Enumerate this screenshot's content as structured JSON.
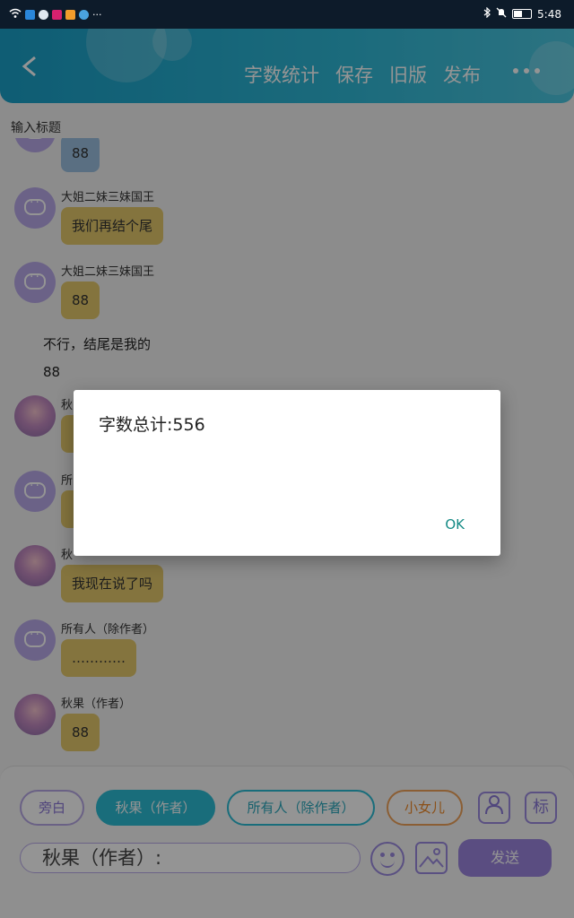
{
  "status_bar": {
    "time": "5:48",
    "battery_level": 0.5,
    "left_icons": [
      "wifi-icon",
      "privacy-icon",
      "cloud-icon",
      "app-badge-icon",
      "play-icon",
      "weather-icon",
      "more-dots-icon"
    ],
    "right_icons": [
      "bluetooth-icon",
      "mute-icon",
      "battery-icon"
    ]
  },
  "header": {
    "back_icon": "chevron-left-icon",
    "actions": [
      "字数统计",
      "保存",
      "旧版",
      "发布"
    ],
    "more_icon": "more-icon"
  },
  "title_placeholder": "输入标题",
  "chat": {
    "messages": [
      {
        "kind": "bubble",
        "avatar": "purple",
        "sender": "",
        "text": "88",
        "color": "blue"
      },
      {
        "kind": "bubble",
        "avatar": "purple",
        "sender": "大姐二妹三妹国王",
        "text": "我们再结个尾",
        "color": "yellow"
      },
      {
        "kind": "bubble",
        "avatar": "purple",
        "sender": "大姐二妹三妹国王",
        "text": "88",
        "color": "yellow"
      },
      {
        "kind": "narration",
        "text": "不行，结尾是我的"
      },
      {
        "kind": "narration",
        "text": "88"
      },
      {
        "kind": "bubble",
        "avatar": "girl",
        "sender": "秋",
        "text": "",
        "color": "yellow"
      },
      {
        "kind": "bubble",
        "avatar": "purple",
        "sender": "所",
        "text": "",
        "color": "yellow"
      },
      {
        "kind": "bubble",
        "avatar": "girl",
        "sender": "秋",
        "text": "我现在说了吗",
        "color": "yellow"
      },
      {
        "kind": "bubble",
        "avatar": "purple",
        "sender": "所有人（除作者）",
        "text": "…………",
        "color": "yellow"
      },
      {
        "kind": "bubble",
        "avatar": "girl",
        "sender": "秋果（作者）",
        "text": "88",
        "color": "yellow"
      }
    ]
  },
  "roles": {
    "narrator": "旁白",
    "author": "秋果（作者）",
    "all_except_author": "所有人（除作者）",
    "little_daughter": "小女儿"
  },
  "tools": {
    "person_icon": "person-icon",
    "mark_label": "标",
    "emoji_icon": "emoji-icon",
    "image_icon": "image-icon"
  },
  "input": {
    "value": "秋果（作者）:"
  },
  "send_label": "发送",
  "dialog": {
    "message": "字数总计:556",
    "ok_label": "OK"
  },
  "colors": {
    "header": "#1aa0c8",
    "bubble_yellow": "#e3c96c",
    "bubble_blue": "#9cc0e0",
    "accent_purple": "#9b86de",
    "author_chip": "#2cbcd4",
    "girl_chip": "#f08a2a",
    "ok_text": "#148a85"
  }
}
